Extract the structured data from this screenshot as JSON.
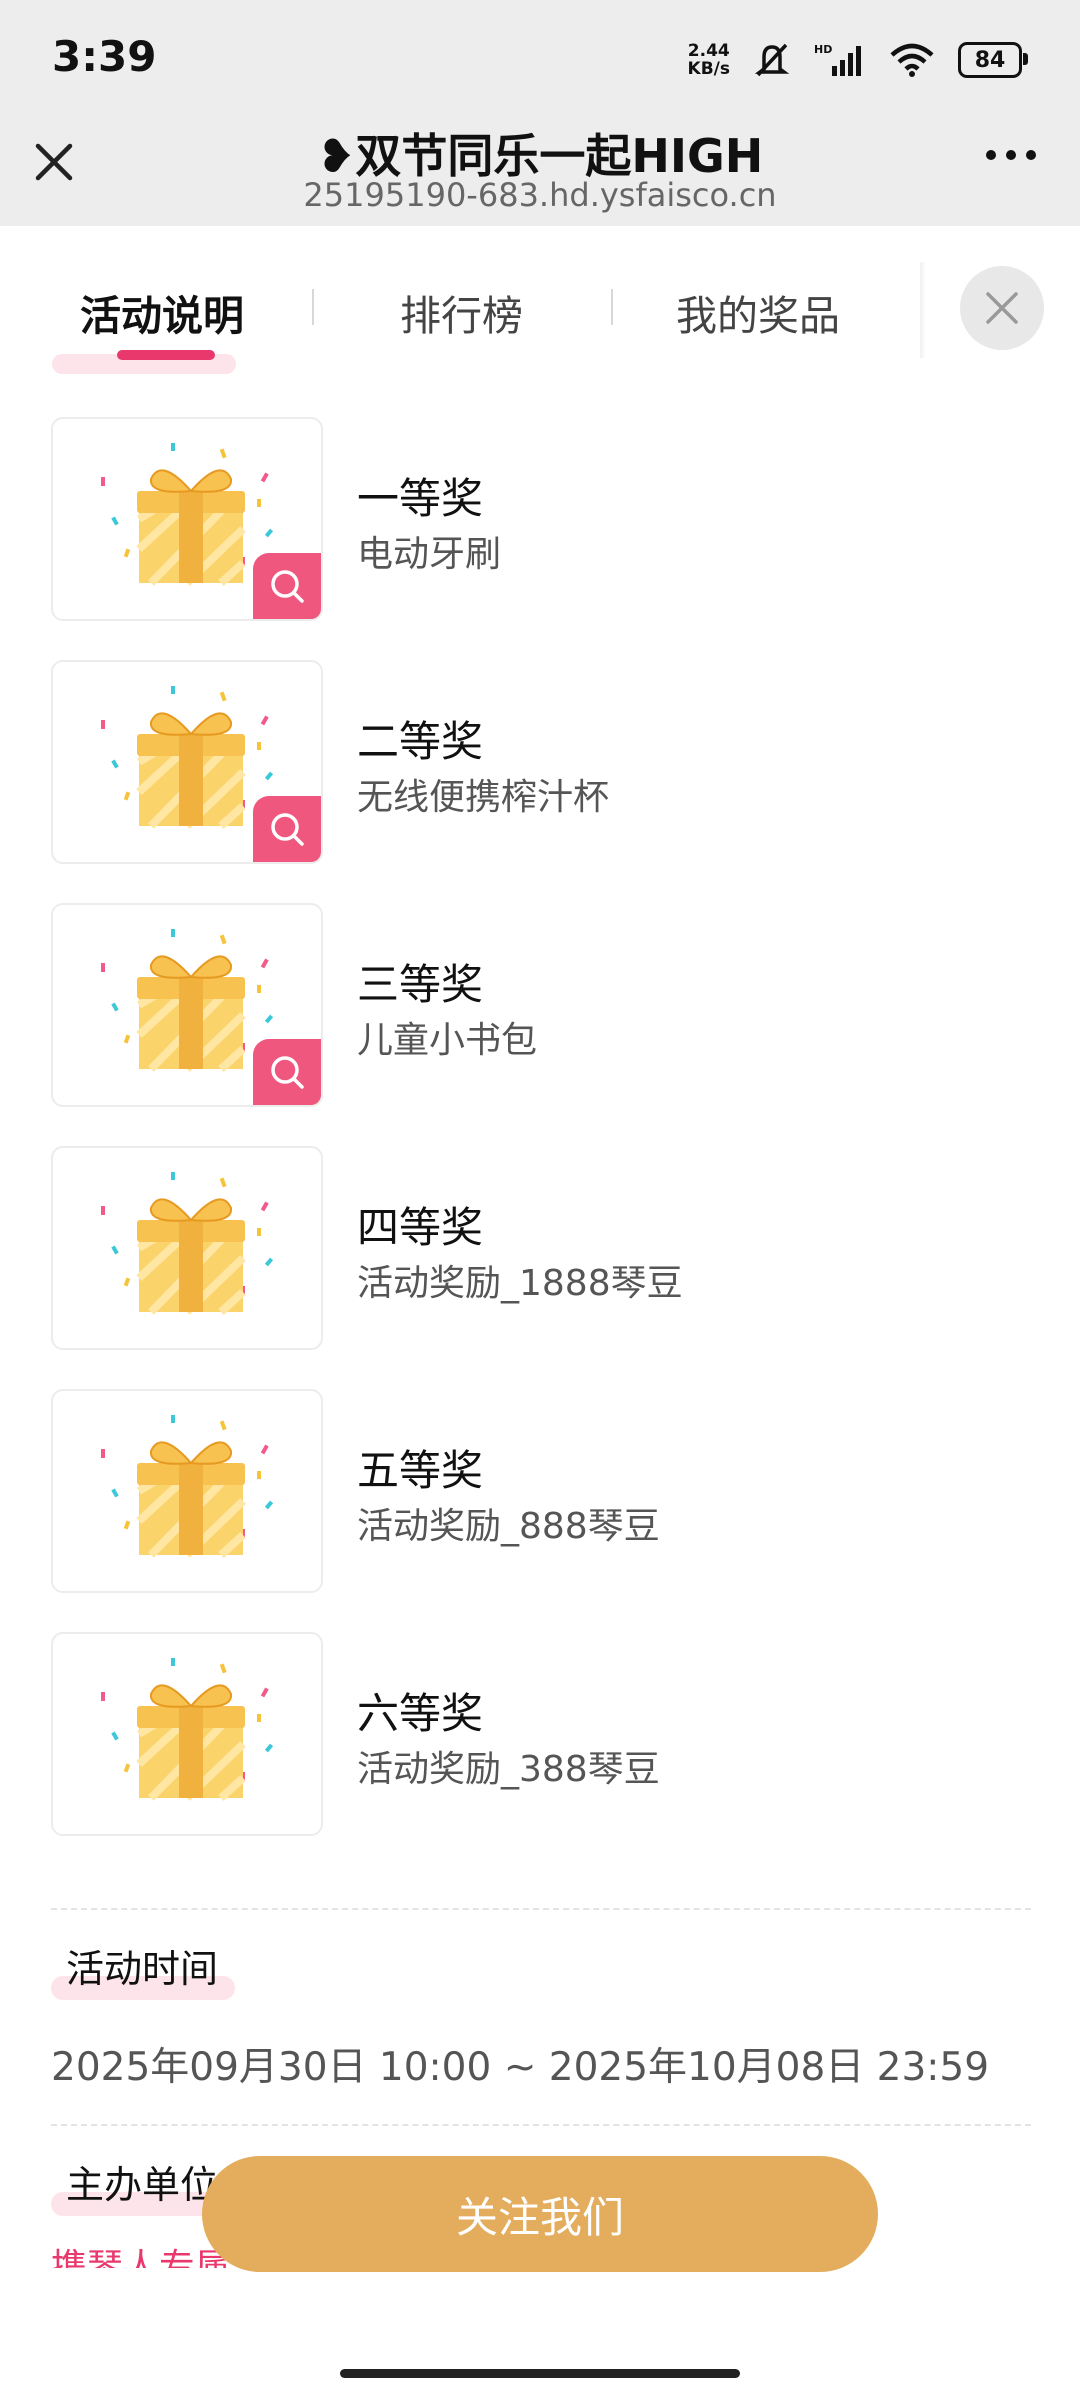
{
  "status_bar": {
    "time": "3:39",
    "net_speed_value": "2.44",
    "net_speed_unit": "KB/s",
    "battery": "84",
    "icons": [
      "mute-icon",
      "hd-signal-icon",
      "wifi-icon",
      "battery-icon"
    ]
  },
  "title_bar": {
    "title": "❥双节同乐一起HIGH",
    "url": "25195190-683.hd.ysfaisco.cn"
  },
  "tabs": [
    {
      "label": "活动说明",
      "active": true
    },
    {
      "label": "排行榜",
      "active": false
    },
    {
      "label": "我的奖品",
      "active": false
    }
  ],
  "prizes": [
    {
      "name": "一等奖",
      "desc": "电动牙刷",
      "zoomable": true
    },
    {
      "name": "二等奖",
      "desc": "无线便携榨汁杯",
      "zoomable": true
    },
    {
      "name": "三等奖",
      "desc": "儿童小书包",
      "zoomable": true
    },
    {
      "name": "四等奖",
      "desc": "活动奖励_1888琴豆",
      "zoomable": false
    },
    {
      "name": "五等奖",
      "desc": "活动奖励_888琴豆",
      "zoomable": false
    },
    {
      "name": "六等奖",
      "desc": "活动奖励_388琴豆",
      "zoomable": false
    }
  ],
  "activity_time": {
    "title": "活动时间",
    "range": "2025年09月30日 10:00 ~ 2025年10月08日 23:59"
  },
  "organizer": {
    "title": "主办单位",
    "value_partial": "携琴人专属"
  },
  "follow_button": "关注我们",
  "colors": {
    "accent_pink": "#e8386c",
    "badge_pink": "#f0577e",
    "button_gold": "#e4ad5e",
    "header_gray": "#ededed"
  }
}
